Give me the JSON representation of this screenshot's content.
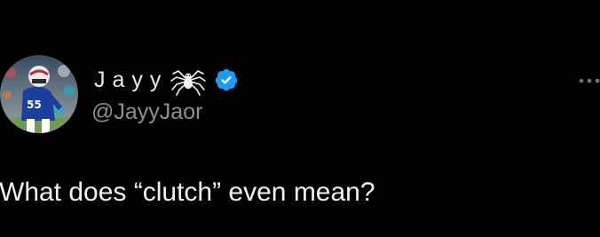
{
  "tweet": {
    "author": {
      "display_name": "Jayy",
      "handle": "@JayyJaor",
      "avatar": "football-player-avatar",
      "name_emoji": "spider-icon",
      "verified": true,
      "verified_badge": "verified-badge-icon"
    },
    "text": "What does “clutch” even mean?",
    "more_menu_icon": "more-options-icon"
  },
  "colors": {
    "background": "#000000",
    "primary_text": "#e7e9ea",
    "secondary_text": "#8b9096",
    "verified_blue": "#1d9bf0"
  }
}
